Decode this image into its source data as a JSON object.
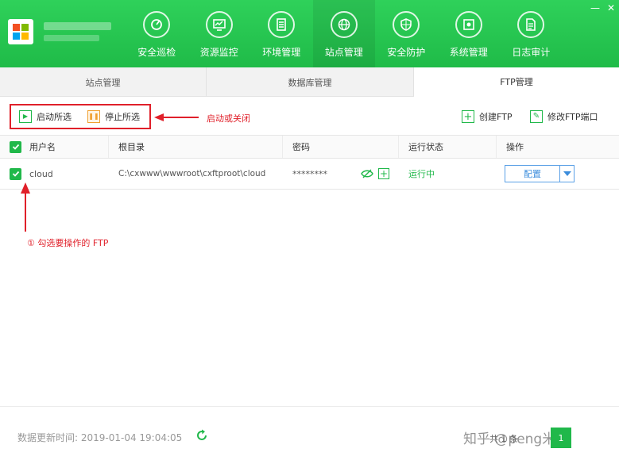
{
  "nav": {
    "items": [
      {
        "label": "安全巡检",
        "icon": "dashboard-icon"
      },
      {
        "label": "资源监控",
        "icon": "monitor-icon"
      },
      {
        "label": "环境管理",
        "icon": "server-icon"
      },
      {
        "label": "站点管理",
        "icon": "globe-icon",
        "active": true
      },
      {
        "label": "安全防护",
        "icon": "shield-icon"
      },
      {
        "label": "系统管理",
        "icon": "settings-icon"
      },
      {
        "label": "日志审计",
        "icon": "document-icon"
      }
    ]
  },
  "window": {
    "minimize": "—",
    "close": "✕"
  },
  "subtabs": [
    {
      "label": "站点管理"
    },
    {
      "label": "数据库管理"
    },
    {
      "label": "FTP管理",
      "active": true
    }
  ],
  "toolbar": {
    "start_label": "启动所选",
    "stop_label": "停止所选",
    "create_label": "创建FTP",
    "modify_port_label": "修改FTP端口"
  },
  "annotations": {
    "start_stop": "启动或关闭",
    "select_ftp": "① 勾选要操作的 FTP"
  },
  "table": {
    "headers": {
      "username": "用户名",
      "root_dir": "根目录",
      "password": "密码",
      "status": "运行状态",
      "action": "操作"
    },
    "rows": [
      {
        "username": "cloud",
        "root_dir": "C:\\cxwww\\wwwroot\\cxftproot\\cloud",
        "password": "********",
        "status": "运行中",
        "action": "配置",
        "checked": true
      }
    ]
  },
  "footer": {
    "update_time_label": "数据更新时间: 2019-01-04 19:04:05",
    "page_info": "共 1 条",
    "current_page": "1"
  },
  "watermark": "知乎 @peng米鹿",
  "colors": {
    "brand_green": "#20b84a",
    "annotation_red": "#e0202a",
    "link_blue": "#3c8ddc"
  }
}
